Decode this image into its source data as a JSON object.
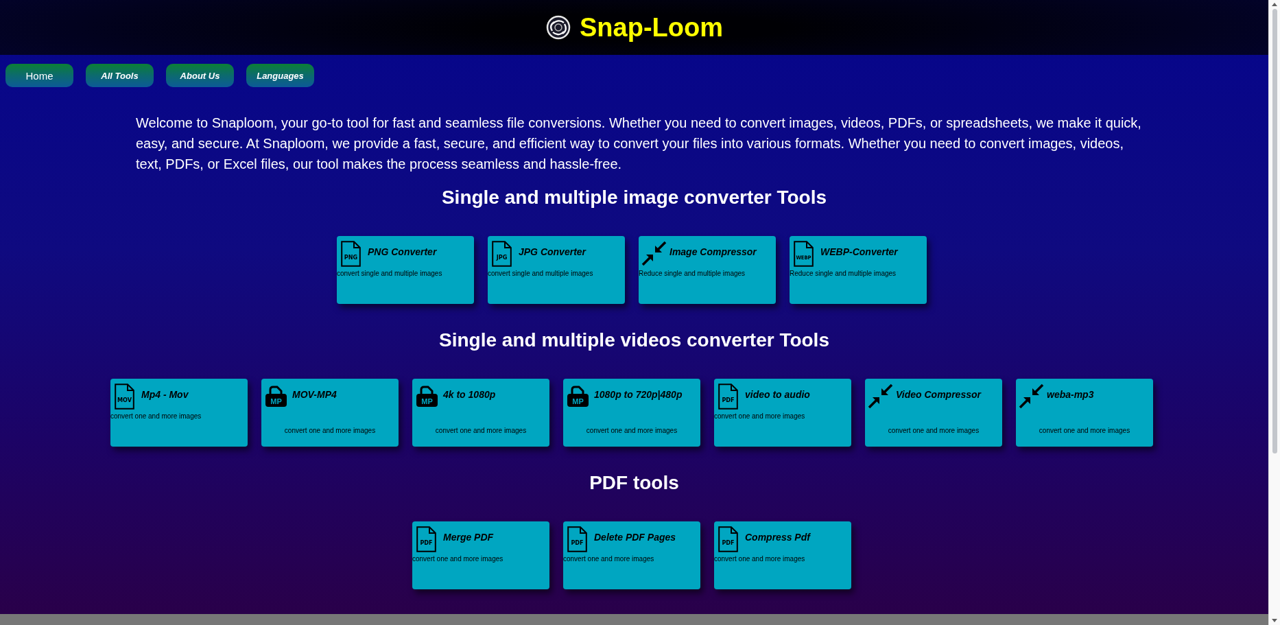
{
  "header": {
    "title": "Snap-Loom"
  },
  "nav": [
    {
      "label": "Home",
      "selected": true
    },
    {
      "label": "All Tools",
      "selected": false
    },
    {
      "label": "About Us",
      "selected": false
    },
    {
      "label": "Languages",
      "selected": false
    }
  ],
  "intro": "Welcome to Snaploom, your go-to tool for fast and seamless file conversions. Whether you need to convert images, videos, PDFs, or spreadsheets, we make it quick, easy, and secure. At Snaploom, we provide a fast, secure, and efficient way to convert your files into various formats. Whether you need to convert images, videos, text, PDFs, or Excel files, our tool makes the process seamless and hassle-free.",
  "sections": [
    {
      "heading": "Single and multiple image converter Tools",
      "tools": [
        {
          "kind": "document",
          "title": "PNG Converter",
          "description": "convert single and multiple images",
          "icon_label": "PNG"
        },
        {
          "kind": "document",
          "title": "JPG Converter",
          "description": "convert single and multiple images",
          "icon_label": "JPG"
        },
        {
          "kind": "arrows",
          "title": "Image Compressor",
          "description": "Reduce single and multiple images"
        },
        {
          "kind": "document",
          "title": "WEBP-Converter",
          "description": "Reduce single and multiple images",
          "icon_label": "WEBP"
        }
      ]
    },
    {
      "heading": "Single and multiple videos converter Tools",
      "tools": [
        {
          "kind": "document",
          "title": "Mp4 - Mov",
          "description": "convert one and more images",
          "icon_label": "MOV"
        },
        {
          "kind": "padlock",
          "title": "MOV-MP4",
          "description": "convert one and more images",
          "icon_label": "MP"
        },
        {
          "kind": "padlock",
          "title": "4k to 1080p",
          "description": "convert one and more images",
          "icon_label": "MP"
        },
        {
          "kind": "padlock",
          "title": "1080p to 720p|480p",
          "description": "convert one and more images",
          "icon_label": "MP"
        },
        {
          "kind": "document",
          "title": "video to audio",
          "description": "convert one and more images",
          "icon_label": "PDF"
        },
        {
          "kind": "arrows-centered",
          "title": "Video Compressor",
          "description": "convert one and more images"
        },
        {
          "kind": "arrows-centered",
          "title": "weba-mp3",
          "description": "convert one and more images"
        }
      ]
    },
    {
      "heading": "PDF tools",
      "tools": [
        {
          "kind": "document",
          "title": "Merge PDF",
          "description": "convert one and more images",
          "icon_label": "PDF"
        },
        {
          "kind": "document",
          "title": "Delete PDF Pages",
          "description": "convert one and more images",
          "icon_label": "PDF"
        },
        {
          "kind": "document",
          "title": "Compress Pdf",
          "description": "convert one and more images",
          "icon_label": "PDF"
        }
      ]
    }
  ]
}
